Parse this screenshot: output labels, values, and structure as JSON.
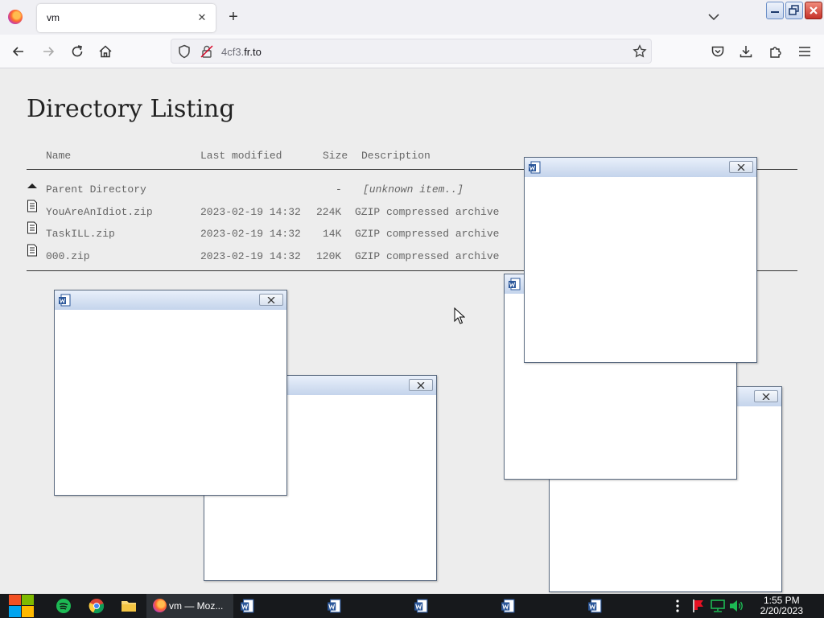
{
  "browser": {
    "tab_title": "vm",
    "url_subdomain": "4cf3.",
    "url_domain": "fr.to"
  },
  "page": {
    "title": "Directory Listing",
    "columns": [
      "Name",
      "Last modified",
      "Size",
      "Description"
    ],
    "rows": [
      {
        "name": "Parent Directory",
        "modified": "",
        "size": "-",
        "description": "[unknown item..]",
        "icon": "parent-arrow-icon"
      },
      {
        "name": "YouAreAnIdiot.zip",
        "modified": "2023-02-19 14:32",
        "size": "224K",
        "description": "GZIP compressed archive",
        "icon": "file-icon"
      },
      {
        "name": "TaskILL.zip",
        "modified": "2023-02-19 14:32",
        "size": "14K",
        "description": "GZIP compressed archive",
        "icon": "file-icon"
      },
      {
        "name": "000.zip",
        "modified": "2023-02-19 14:32",
        "size": "120K",
        "description": "GZIP compressed archive",
        "icon": "file-icon"
      }
    ]
  },
  "popups": [
    {
      "icon": "word-document-icon"
    },
    {
      "icon": "word-document-icon"
    },
    {
      "icon": "word-document-icon"
    },
    {
      "icon": "word-document-icon"
    },
    {
      "icon": "word-document-icon"
    }
  ],
  "taskbar": {
    "active_task_label": "vm — Moz...",
    "clock_time": "1:55 PM",
    "clock_date": "2/20/2023",
    "colors": {
      "background": "#17191c",
      "active": "#2d3136"
    }
  }
}
